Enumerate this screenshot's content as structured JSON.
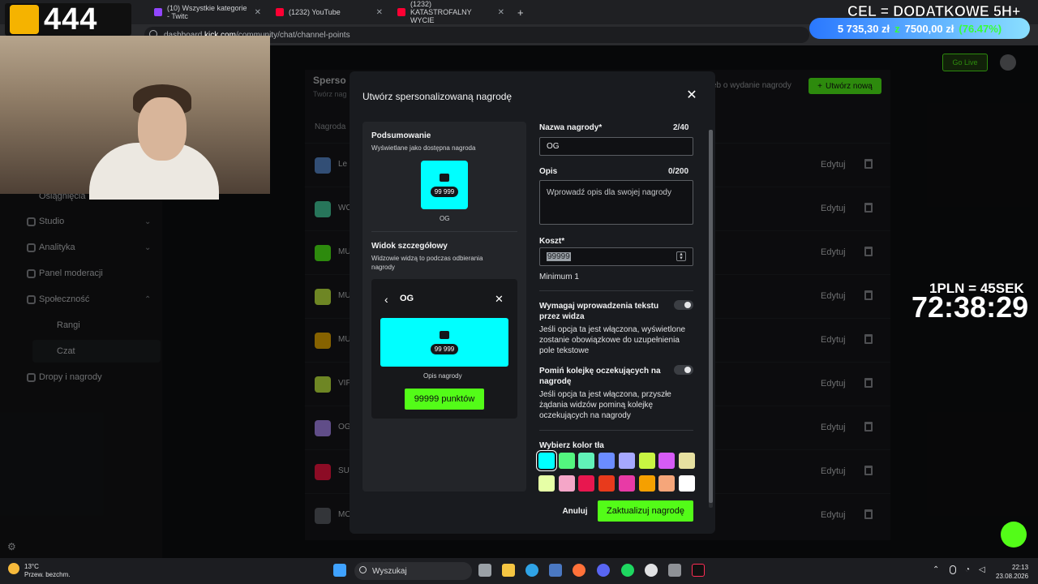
{
  "browser": {
    "tabs": [
      {
        "label": "(10) Wszystkie kategorie - Twitc",
        "color": "#9146ff"
      },
      {
        "label": "(1232) YouTube",
        "color": "#ff0033"
      },
      {
        "label": "(1232) KATASTROFALNY WYCIE",
        "color": "#ff0033"
      }
    ],
    "url_prefix": "dashboard.",
    "url_domain": "kick.com",
    "url_path": "/community/chat/channel-points"
  },
  "sidebar": {
    "items": [
      {
        "label": "Osiągnięcia"
      },
      {
        "label": "Studio"
      },
      {
        "label": "Analityka"
      },
      {
        "label": "Panel moderacji"
      },
      {
        "label": "Społeczność"
      },
      {
        "label": "Rangi"
      },
      {
        "label": "Czat"
      },
      {
        "label": "Dropy i nagrody"
      }
    ]
  },
  "header": {
    "partial_title": "Sperso",
    "partial_sub": "Twórz nag",
    "partial_filter": "eb o wydanie nagrody",
    "create_label": "Utwórz nową",
    "go_live_label": "Go Live",
    "col_header": "Nagroda"
  },
  "rewards": {
    "rows": [
      {
        "name": "Le",
        "color": "#5b8fd6",
        "edit": "Edytuj"
      },
      {
        "name": "WO",
        "color": "#47d6a4",
        "edit": "Edytuj"
      },
      {
        "name": "MU",
        "color": "#53fc18",
        "edit": "Edytuj"
      },
      {
        "name": "MU",
        "color": "#c8f542",
        "edit": "Edytuj"
      },
      {
        "name": "MU",
        "color": "#f5b300",
        "edit": "Edytuj"
      },
      {
        "name": "VIP",
        "color": "#c8f542",
        "edit": "Edytuj"
      },
      {
        "name": "OG",
        "color": "#b08cf7",
        "edit": "Edytuj"
      },
      {
        "name": "SU",
        "color": "#ff1744",
        "edit": "Edytuj"
      },
      {
        "name": "MO",
        "color": "#5d6168",
        "edit": "Edytuj"
      }
    ]
  },
  "modal": {
    "title": "Utwórz spersonalizowaną nagrodę",
    "summary_title": "Podsumowanie",
    "summary_sub": "Wyświetlane jako dostępna nagroda",
    "card_cost": "99 999",
    "card_name": "OG",
    "detail_title": "Widok szczegółowy",
    "detail_sub": "Widzowie widzą to podczas odbierania nagrody",
    "detail_name": "OG",
    "detail_desc": "Opis nagrody",
    "detail_button": "99999 punktów",
    "name_label": "Nazwa nagrody*",
    "name_count": "2/40",
    "name_value": "OG",
    "desc_label": "Opis",
    "desc_count": "0/200",
    "desc_placeholder": "Wprowadź opis dla swojej nagrody",
    "cost_label": "Koszt*",
    "cost_value": "99999",
    "cost_min": "Minimum 1",
    "toggle1_label": "Wymagaj wprowadzenia tekstu przez widza",
    "toggle1_desc": "Jeśli opcja ta jest włączona, wyświetlone zostanie obowiązkowe do uzupełnienia pole tekstowe",
    "toggle2_label": "Pomiń kolejkę oczekujących na nagrodę",
    "toggle2_desc": "Jeśli opcja ta jest włączona, przyszłe żądania widzów pominą kolejkę oczekujących na nagrody",
    "color_label": "Wybierz kolor tła",
    "colors_row1": [
      "#00ffff",
      "#53f57f",
      "#61f2b8",
      "#6b8cff",
      "#a6a8ff",
      "#c8f542",
      "#d65bf5",
      "#e6e0a0"
    ],
    "colors_row2": [
      "#e6ffa6",
      "#f5a6c8",
      "#e8174f",
      "#e83a1c",
      "#e83aa6",
      "#f5a000",
      "#f5a67a",
      "#ffffff"
    ],
    "selected_color": "#00ffff",
    "cancel_label": "Anuluj",
    "submit_label": "Zaktualizuj nagrodę"
  },
  "overlay": {
    "logo_text": "444",
    "goal_title": "CEL = DODATKOWE 5H+",
    "goal_current": "5 735,30 zł",
    "goal_sep": "z",
    "goal_target": "7500,00 zł",
    "goal_pct": "(76.47%)",
    "rate": "1PLN = 45SEK",
    "timer": "72:38:29"
  },
  "taskbar": {
    "temp": "13°C",
    "weather": "Przew. bezchm.",
    "search_placeholder": "Wyszukaj",
    "time": "22:13",
    "date": "23.08.2026"
  }
}
